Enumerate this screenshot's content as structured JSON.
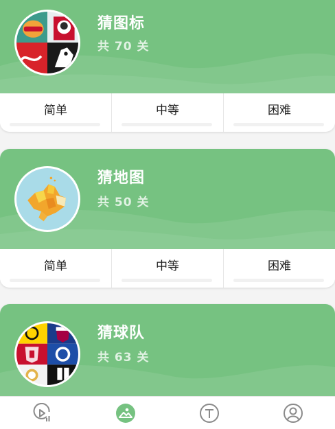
{
  "colors": {
    "banner": "#76c281",
    "tab_active": "#76c281",
    "tab_inactive": "#8a8a8a"
  },
  "categories": [
    {
      "title": "猜图标",
      "count": "共 70 关",
      "thumbnail_icon": "logo-collage-icon",
      "levels": [
        "简单",
        "中等",
        "困难"
      ]
    },
    {
      "title": "猜地图",
      "count": "共 50 关",
      "thumbnail_icon": "map-icon",
      "levels": [
        "简单",
        "中等",
        "困难"
      ]
    },
    {
      "title": "猜球队",
      "count": "共 63 关",
      "thumbnail_icon": "football-badges-icon"
    }
  ],
  "tabbar": {
    "items": [
      {
        "icon": "play-chart-icon",
        "active": false
      },
      {
        "icon": "image-icon",
        "active": true
      },
      {
        "icon": "text-icon",
        "active": false
      },
      {
        "icon": "user-icon",
        "active": false
      }
    ]
  }
}
